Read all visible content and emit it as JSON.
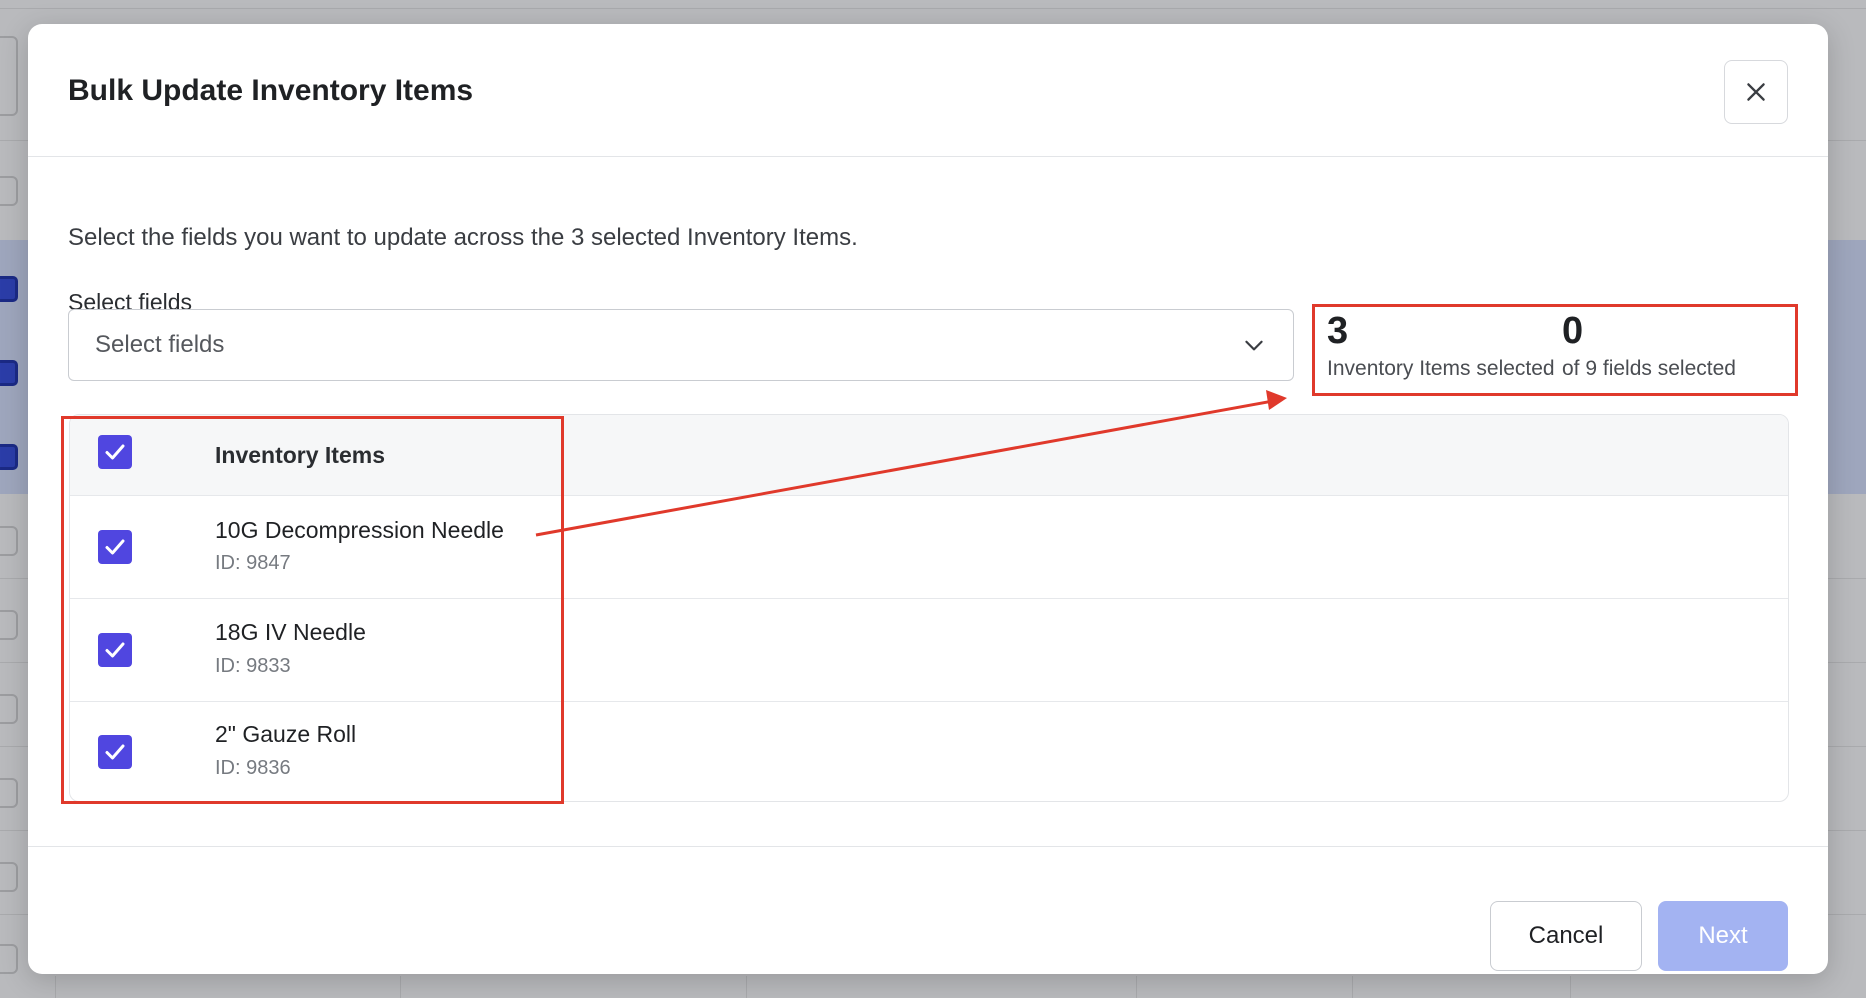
{
  "modal": {
    "title": "Bulk Update Inventory Items",
    "description": "Select the fields you want to update across the 3 selected Inventory Items.",
    "field_label": "Select fields",
    "select_placeholder": "Select fields"
  },
  "stats": {
    "items_count": "3",
    "items_label": "Inventory Items selected",
    "fields_count": "0",
    "fields_label": "of 9 fields selected"
  },
  "table": {
    "header": "Inventory Items",
    "header_checked": true,
    "rows": [
      {
        "name": "10G Decompression Needle",
        "id": "ID: 9847",
        "checked": true
      },
      {
        "name": "18G IV Needle",
        "id": "ID: 9833",
        "checked": true
      },
      {
        "name": "2\" Gauze Roll",
        "id": "ID: 9836",
        "checked": true
      }
    ]
  },
  "footer": {
    "cancel_label": "Cancel",
    "next_label": "Next",
    "next_disabled": true
  },
  "colors": {
    "accent": "#5046e0",
    "next_disabled_bg": "#a3b3f2",
    "annotation": "#e0392b"
  },
  "icons": {
    "close": "close-icon",
    "dropdown": "chevron-down-icon",
    "checkbox": "checkmark-icon"
  }
}
